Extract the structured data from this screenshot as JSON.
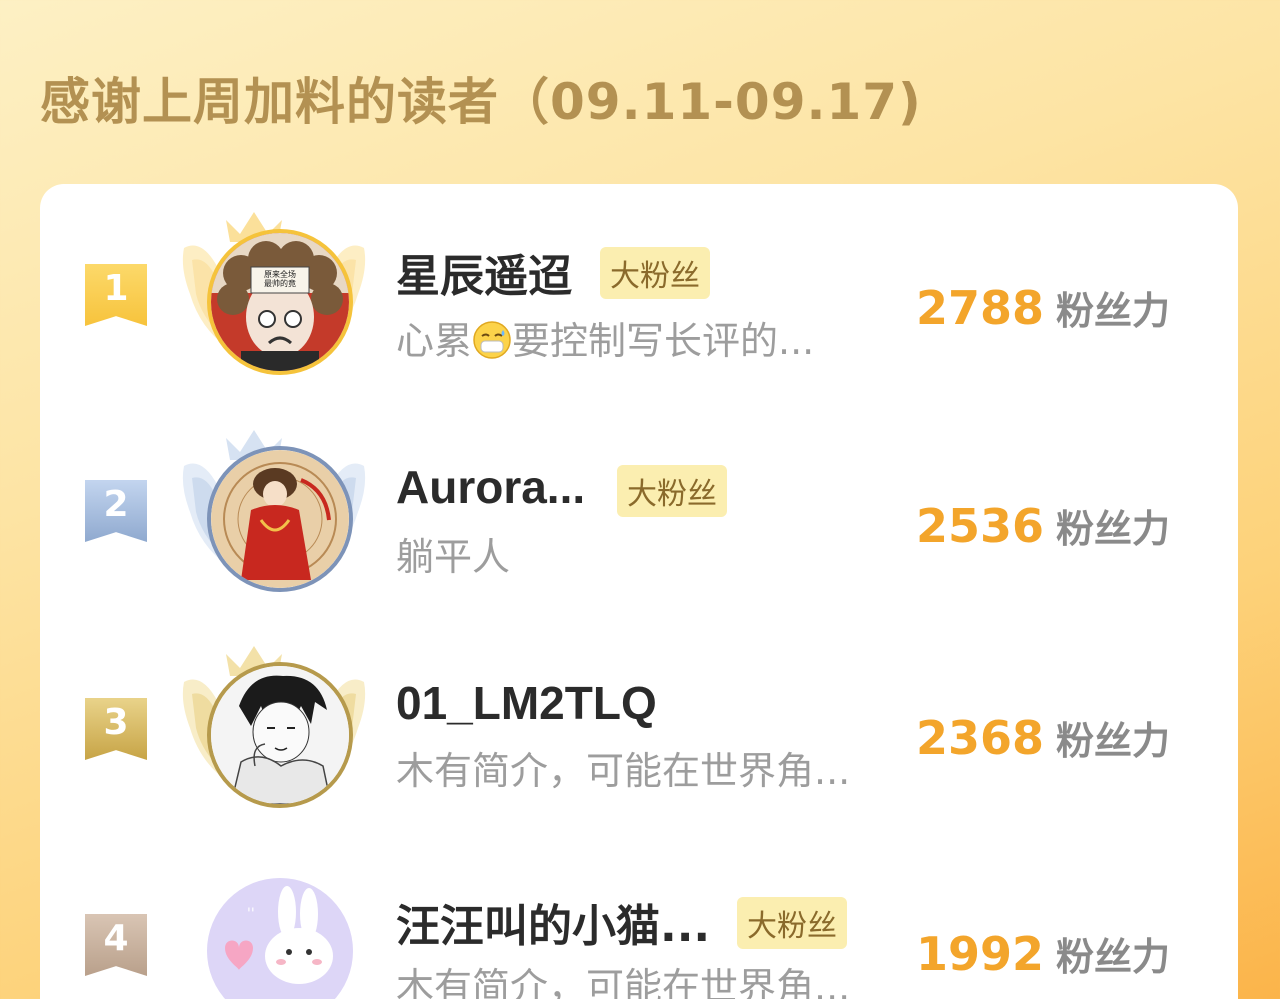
{
  "header": {
    "title": "感谢上周加料的读者（09.11-09.17)"
  },
  "colors": {
    "accent_orange": "#f3a52b",
    "title_brown": "#b39152",
    "badge_bg": "#fbeeb0"
  },
  "ranking": [
    {
      "rank": "1",
      "name": "星辰遥迢",
      "badge": "大粉丝",
      "bio_before": "心累",
      "bio_emoji": "mask-face-emoji",
      "bio_after": "要控制写长评的...",
      "score": "2788",
      "score_unit": "粉丝力",
      "avatar_text": "原来全场最帅的竟是我自己"
    },
    {
      "rank": "2",
      "name": "Aurora...",
      "badge": "大粉丝",
      "bio": "躺平人",
      "score": "2536",
      "score_unit": "粉丝力"
    },
    {
      "rank": "3",
      "name": "01_LM2TLQ",
      "badge": "",
      "bio": "木有简介，可能在世界角...",
      "score": "2368",
      "score_unit": "粉丝力"
    },
    {
      "rank": "4",
      "name": "汪汪叫的小猫...",
      "badge": "大粉丝",
      "bio": "木有简介，可能在世界角...",
      "score": "1992",
      "score_unit": "粉丝力"
    }
  ]
}
